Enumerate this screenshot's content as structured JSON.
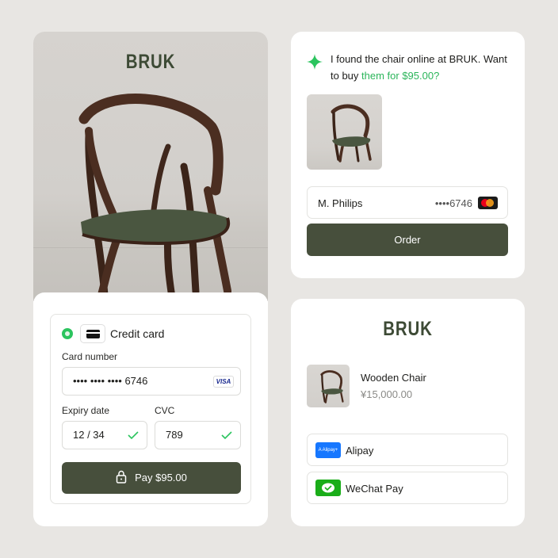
{
  "product": {
    "brand": "BRUK"
  },
  "payment_form": {
    "method_label": "Credit card",
    "card_number_label": "Card number",
    "card_number_value": "•••• •••• •••• 6746",
    "card_brand": "VISA",
    "expiry_label": "Expiry date",
    "expiry_value": "12 / 34",
    "cvc_label": "CVC",
    "cvc_value": "789",
    "pay_button": "Pay $95.00",
    "accent_color": "#2bc45e",
    "button_color": "#474f3c"
  },
  "chat": {
    "message_prefix": "I found the chair online at BRUK. Want to buy ",
    "message_accent": "them for $95.00?",
    "account_name": "M. Philips",
    "account_number": "••••6746",
    "order_button": "Order",
    "accent_color": "#2bb55a"
  },
  "checkout": {
    "brand": "BRUK",
    "item_name": "Wooden Chair",
    "item_price": "¥15,000.00",
    "methods": [
      {
        "name": "Alipay",
        "logo_text": "A Alipay+"
      },
      {
        "name": "WeChat Pay"
      }
    ]
  }
}
